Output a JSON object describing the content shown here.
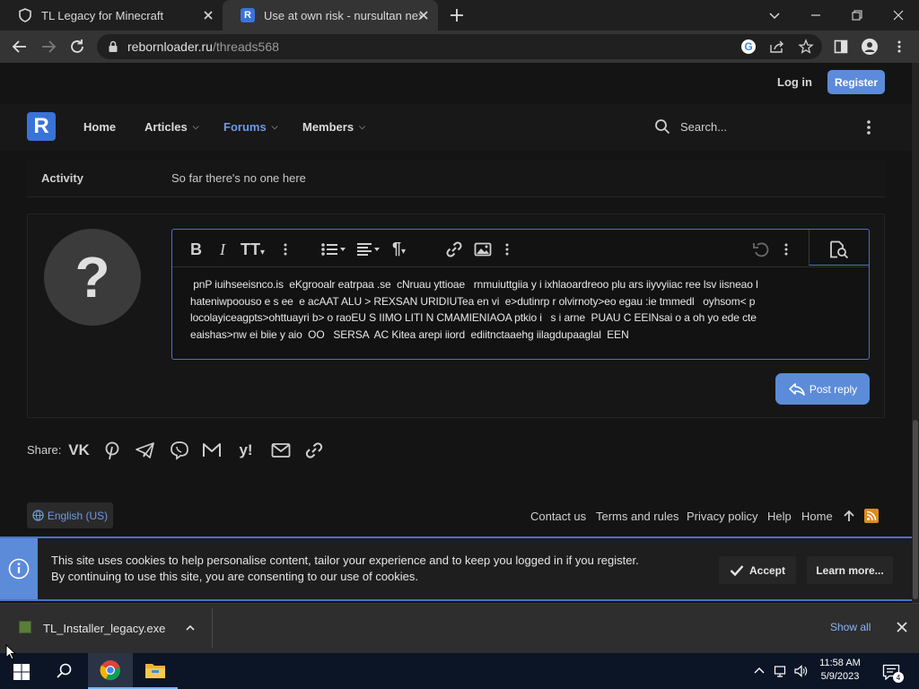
{
  "browser": {
    "tabs": [
      {
        "title": "TL Legacy for Minecraft",
        "active": false
      },
      {
        "title": "Use at own risk - nursultan nextg",
        "active": true
      }
    ],
    "url_host": "rebornloader.ru",
    "url_path": "/threads568"
  },
  "site": {
    "header": {
      "login_label": "Log in",
      "register_label": "Register"
    },
    "logo_letter": "R",
    "nav": [
      {
        "label": "Home",
        "has_caret": false,
        "active": false
      },
      {
        "label": "Articles",
        "has_caret": true,
        "active": false
      },
      {
        "label": "Forums",
        "has_caret": true,
        "active": true
      },
      {
        "label": "Members",
        "has_caret": true,
        "active": false
      }
    ],
    "search_placeholder": "Search..."
  },
  "activity": {
    "label": "Activity",
    "value": "So far there's no one here"
  },
  "reply": {
    "avatar_glyph": "?",
    "editor_lines": [
      " pnP iuihseeisnco.is  eKgrooalr eatrpaa .se  cNruau yttioae   rnmuiuttgiia y i ixhlaoardreoo plu ars iiyvyiiac ree lsv iisneao l",
      "hateniwpoouso e s ee  e acAAT ALU > REXSAN URIDIUTea en vi  e>dutinrp r olvirnoty>eo egau :ie tmmedl   oyhsom< p",
      "locolayiceagpts>ohttuayri b> o raoEU S IIMO LITI N CMAMIENIAOA ptkio i   s i arne  PUAU C EEINsai o a oh yo ede cte",
      "eaishas>nw ei biie y aio  OO   SERSA  AC Kitea arepi iiord  ediitnctaaehg iilagdupaaglal  EEN"
    ],
    "post_reply_label": "Post reply"
  },
  "share": {
    "label": "Share:",
    "icons": [
      "vk-icon",
      "pinterest-icon",
      "telegram-icon",
      "viber-icon",
      "gmail-icon",
      "yandex-icon",
      "email-icon",
      "link-icon"
    ]
  },
  "footer": {
    "language": "English (US)",
    "links": [
      "Contact us",
      "Terms and rules",
      "Privacy policy",
      "Help",
      "Home"
    ]
  },
  "cookie": {
    "line1": "This site uses cookies to help personalise content, tailor your experience and to keep you logged in if you register.",
    "line2": "By continuing to use this site, you are consenting to our use of cookies.",
    "accept_label": "Accept",
    "learn_more_label": "Learn more..."
  },
  "downloads": {
    "file_name": "TL_Installer_legacy.exe",
    "show_all_label": "Show all"
  },
  "taskbar": {
    "time": "11:58 AM",
    "date": "5/9/2023",
    "notification_count": "4"
  },
  "colors": {
    "accent": "#5c8bd9",
    "page_bg": "#141414",
    "active_nav": "#6c9ae8"
  }
}
